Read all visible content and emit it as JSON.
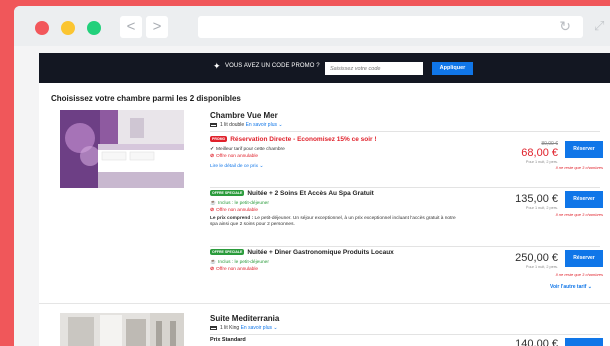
{
  "browser": {
    "back": "<",
    "forward": ">",
    "reload": "↻",
    "expand": "⤢"
  },
  "promo": {
    "text": "VOUS AVEZ UN CODE PROMO ?",
    "placeholder": "Saisissez votre code",
    "apply": "Appliquer"
  },
  "section_title": "Choisissez votre chambre parmi les 2 disponibles",
  "rooms": [
    {
      "name": "Chambre Vue Mer",
      "bed": "1 lit double",
      "more": "En savoir plus ⌄",
      "offers": [
        {
          "badge": "PROMO",
          "title": "Réservation Directe - Economisez 15% ce soir !",
          "features": [
            "Meilleur tarif pour cette chambre",
            "Offre non annulable"
          ],
          "link": "Lire le détail de ce prix ⌄",
          "old_price": "80,00 €",
          "price": "68,00 €",
          "price_note": "Pour 1 nuit, 2 pers.",
          "reserve": "Réserver",
          "remaining": "Il ne reste que 3 chambres"
        },
        {
          "badge": "OFFRE SPECIALE",
          "title": "Nuitée + 2 Soins Et Accès Au Spa Gratuit",
          "features": [
            "Inclus : le petit-déjeuner",
            "Offre non annulable"
          ],
          "description_bold": "Le prix comprend :",
          "description": " Le petit-déjeuner. Un séjour exceptionnel, à un prix exceptionnel incluant l'accès gratuit à notre spa ainsi que 2 soins pour 2 personnes.",
          "price": "135,00 €",
          "price_note": "Pour 1 nuit, 2 pers.",
          "reserve": "Réserver",
          "remaining": "Il ne reste que 3 chambres"
        },
        {
          "badge": "OFFRE SPECIALE",
          "title": "Nuitée + Dîner Gastronomique Produits Locaux",
          "features": [
            "Inclus : le petit-déjeuner",
            "Offre non annulable"
          ],
          "price": "250,00 €",
          "price_note": "Pour 1 nuit, 2 pers.",
          "reserve": "Réserver",
          "remaining": "Il ne reste que 3 chambres"
        }
      ],
      "other_rate": "Voir l'autre tarif ⌄"
    },
    {
      "name": "Suite Mediterrania",
      "bed": "1 lit King",
      "more": "En savoir plus ⌄",
      "offers": [
        {
          "title": "Prix Standard",
          "price": "140,00 €"
        }
      ]
    }
  ],
  "colors": {
    "background": "#f0575a",
    "promo_bar": "#131722",
    "accent_blue": "#1076e8",
    "promo_red": "#e0212b",
    "inclusion_green": "#2a9b3b"
  },
  "icons": {
    "tag": "tag-icon",
    "bed": "bed-icon",
    "check": "check-icon",
    "no": "forbidden-icon",
    "cup": "breakfast-icon"
  }
}
